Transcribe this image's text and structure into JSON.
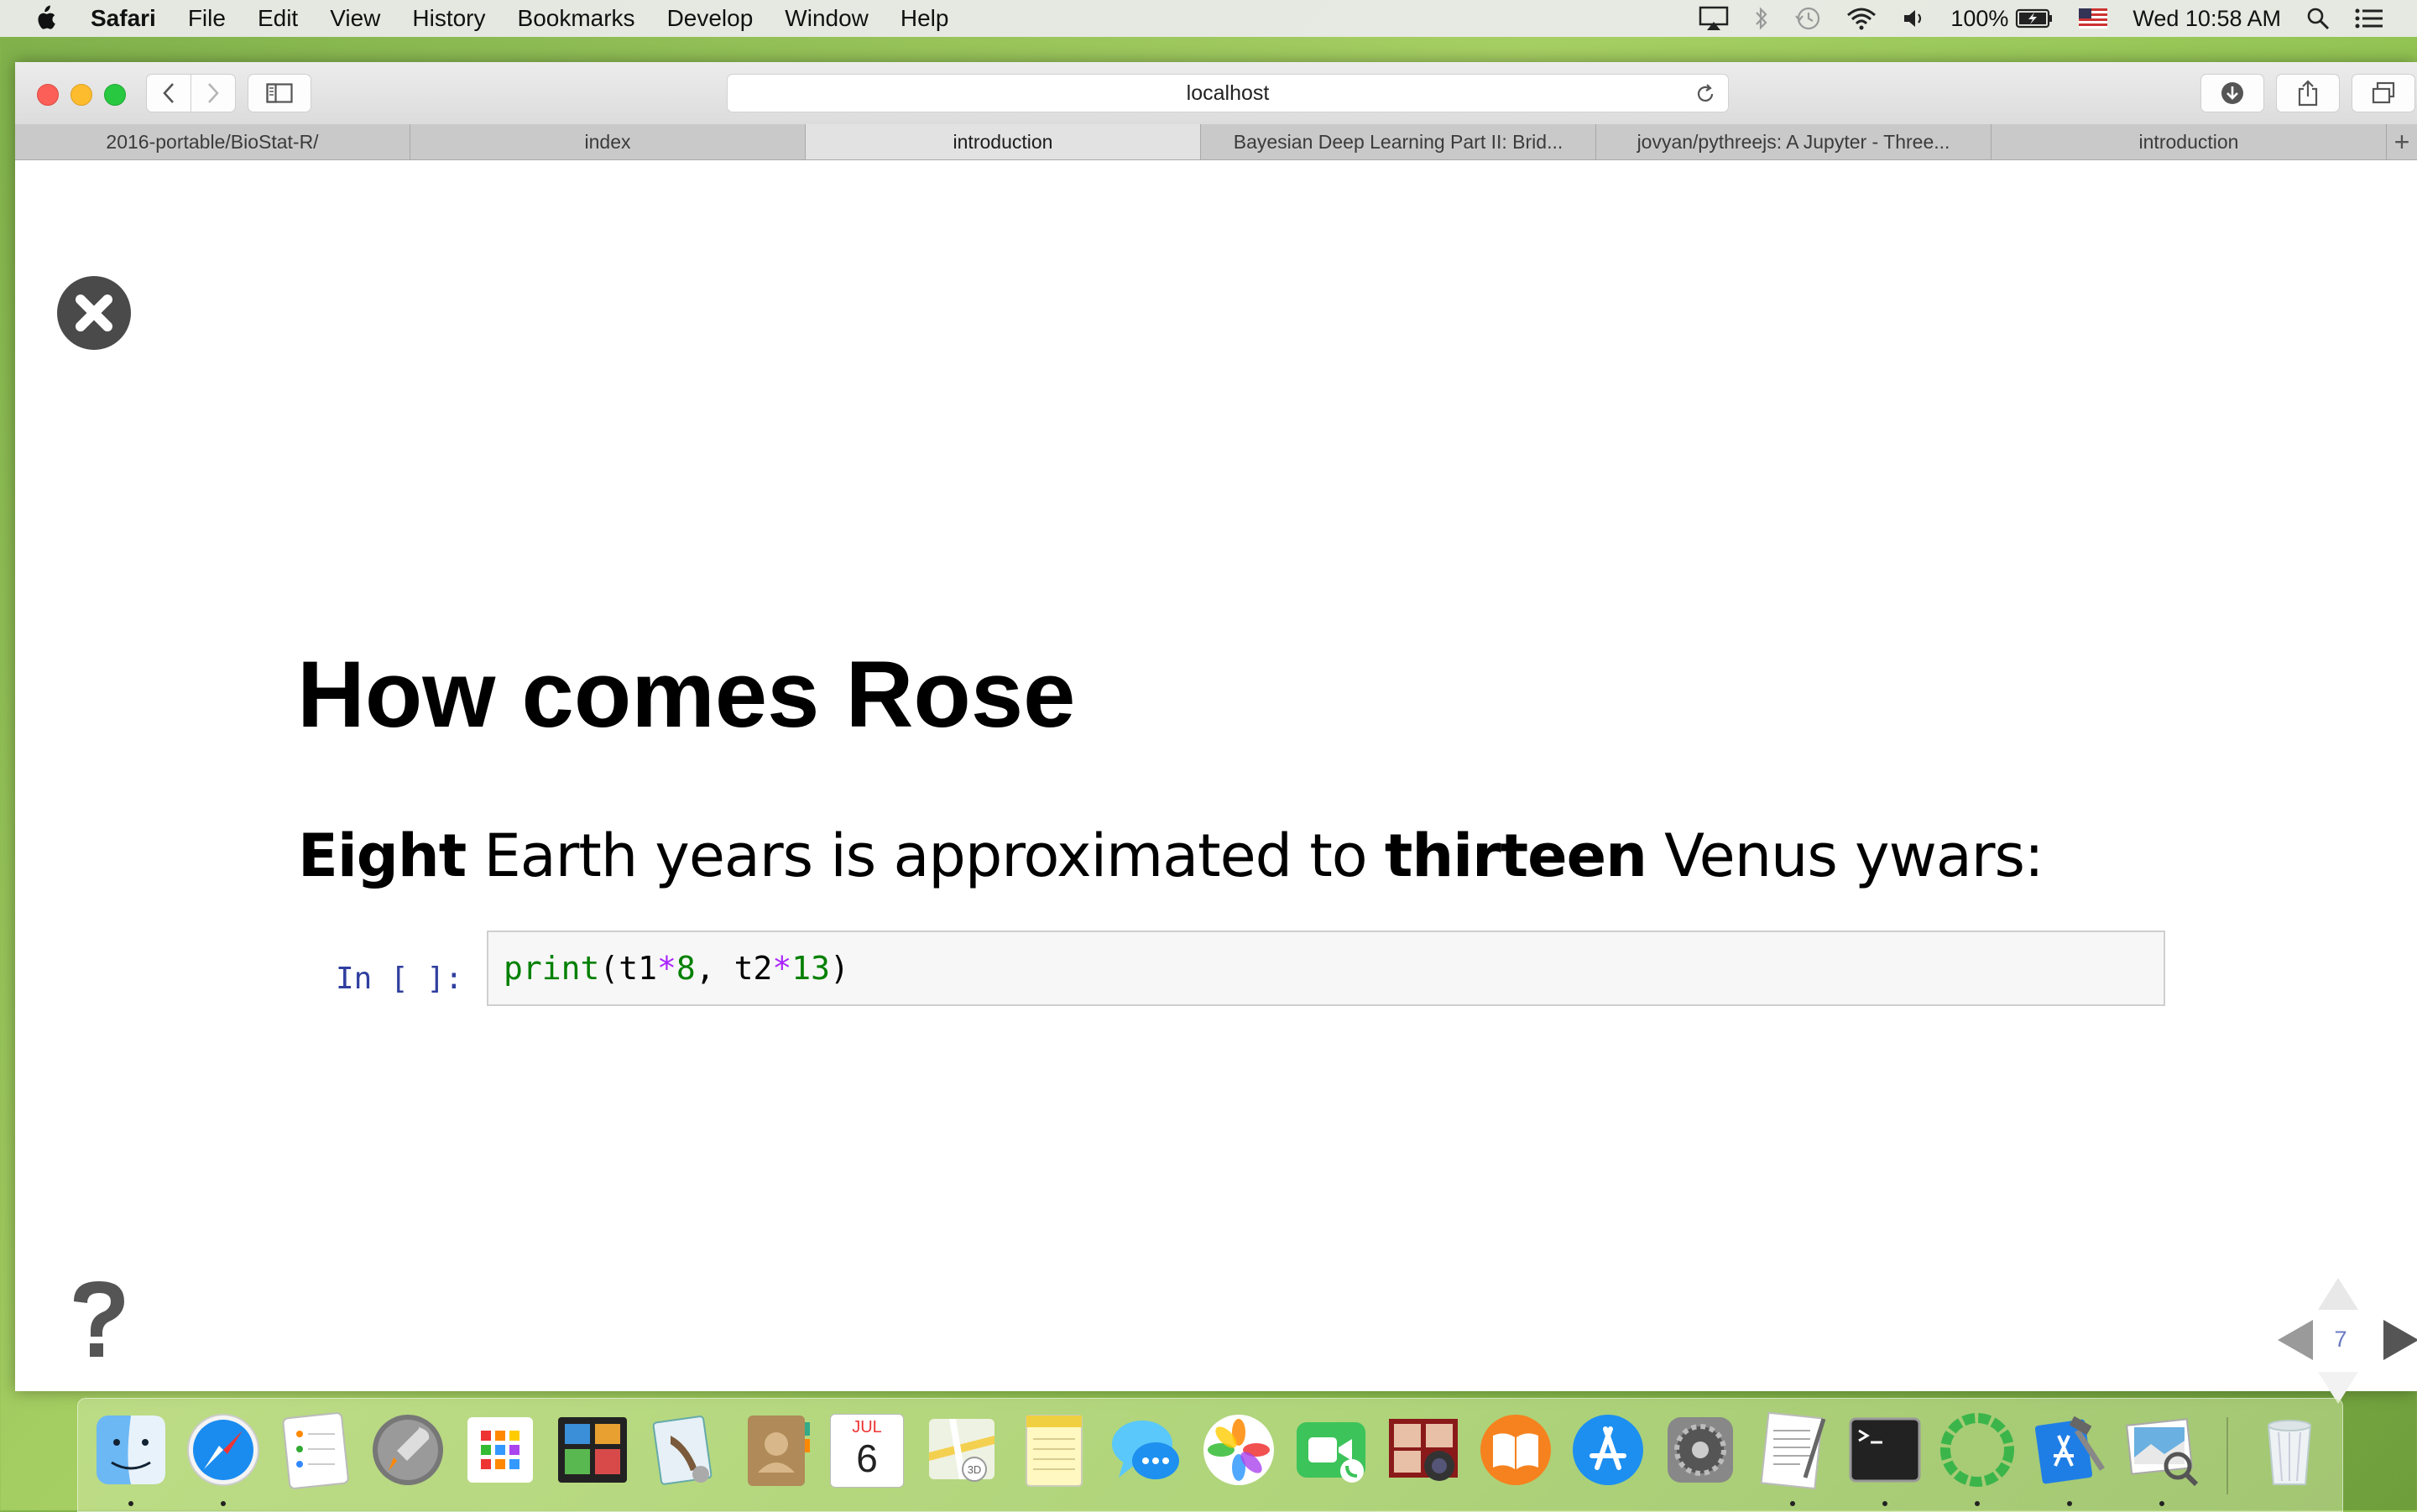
{
  "menubar": {
    "app_name": "Safari",
    "items": [
      "File",
      "Edit",
      "View",
      "History",
      "Bookmarks",
      "Develop",
      "Window",
      "Help"
    ],
    "status": {
      "battery": "100%",
      "clock": "Wed 10:58 AM"
    }
  },
  "browser": {
    "url": "localhost",
    "tabs": [
      {
        "label": "2016-portable/BioStat-R/"
      },
      {
        "label": "index"
      },
      {
        "label": "introduction"
      },
      {
        "label": "Bayesian Deep Learning Part II: Brid..."
      },
      {
        "label": "jovyan/pythreejs: A Jupyter - Three..."
      },
      {
        "label": "introduction"
      }
    ],
    "active_tab_index": 2,
    "new_tab_label": "+"
  },
  "slide": {
    "title": "How comes Rose",
    "subtitle": {
      "b1": "Eight",
      "t1": " Earth years is approximated to ",
      "b2": "thirteen",
      "t2": " Venus ywars:"
    },
    "cell": {
      "prompt": "In [ ]:",
      "code": {
        "fn": "print",
        "p1": "(t1",
        "star1": "*",
        "n1": "8",
        "mid": ", t2",
        "star2": "*",
        "n2": "13",
        "end": ")"
      }
    },
    "slide_number": "7"
  },
  "dock": {
    "apps": [
      "finder",
      "safari",
      "reminders",
      "launchpad",
      "launchpad-grid",
      "photo-booth-screens",
      "mail",
      "contacts",
      "calendar",
      "maps",
      "notes",
      "messages",
      "photos",
      "facetime",
      "photo-booth",
      "ibooks",
      "app-store",
      "system-preferences",
      "textedit",
      "terminal",
      "activity-ring-app",
      "xcode",
      "preview",
      "trash"
    ],
    "calendar_month": "JUL",
    "calendar_day": "6"
  },
  "colors": {
    "prompt": "#303f9f",
    "code_builtin": "#008000",
    "code_operator": "#aa22ff",
    "traffic_close": "#fc5f57",
    "traffic_min": "#fdbc2e",
    "traffic_max": "#28c840"
  }
}
